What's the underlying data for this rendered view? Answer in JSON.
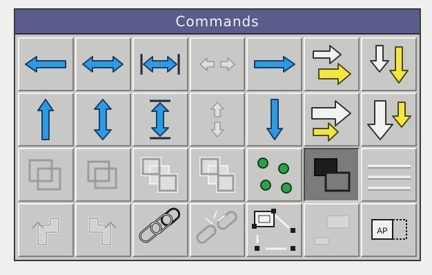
{
  "window": {
    "title": "Commands"
  },
  "buttons": [
    {
      "icon": "arrow-left-icon",
      "enabled": true
    },
    {
      "icon": "arrow-left-right-icon",
      "enabled": true
    },
    {
      "icon": "expand-horizontal-icon",
      "enabled": true
    },
    {
      "icon": "disabled-arrows-horizontal-icon",
      "enabled": false
    },
    {
      "icon": "arrow-right-icon",
      "enabled": true
    },
    {
      "icon": "outline-arrows-right-icon",
      "enabled": true
    },
    {
      "icon": "outline-arrows-down-icon",
      "enabled": true
    },
    {
      "icon": "arrow-up-icon",
      "enabled": true
    },
    {
      "icon": "arrow-up-down-icon",
      "enabled": true
    },
    {
      "icon": "expand-vertical-icon",
      "enabled": true
    },
    {
      "icon": "disabled-arrows-vertical-icon",
      "enabled": false
    },
    {
      "icon": "arrow-down-icon",
      "enabled": true
    },
    {
      "icon": "outline-arrows-right-alt-icon",
      "enabled": true
    },
    {
      "icon": "outline-arrows-down-alt-icon",
      "enabled": true
    },
    {
      "icon": "disabled-layer-icon",
      "enabled": false
    },
    {
      "icon": "disabled-layer-icon-2",
      "enabled": false
    },
    {
      "icon": "disabled-group-icon",
      "enabled": false
    },
    {
      "icon": "disabled-group-icon-2",
      "enabled": false
    },
    {
      "icon": "green-dots-icon",
      "enabled": true
    },
    {
      "icon": "overlap-boxes-icon",
      "enabled": true,
      "pressed": true
    },
    {
      "icon": "horizontal-lines-icon",
      "enabled": false
    },
    {
      "icon": "disabled-rotate-left-icon",
      "enabled": false
    },
    {
      "icon": "disabled-rotate-right-icon",
      "enabled": false
    },
    {
      "icon": "link-chain-icon",
      "enabled": true
    },
    {
      "icon": "broken-link-icon",
      "enabled": false
    },
    {
      "icon": "resize-handles-icon",
      "enabled": true
    },
    {
      "icon": "disabled-align-boxes-icon",
      "enabled": false
    },
    {
      "icon": "text-frame-icon",
      "enabled": true
    }
  ],
  "text_frame_label": "AP",
  "colors": {
    "titlebar": "#5a5d8c",
    "accent_blue": "#2c9be1",
    "accent_yellow": "#f3e63c",
    "accent_green": "#2aa24a"
  }
}
